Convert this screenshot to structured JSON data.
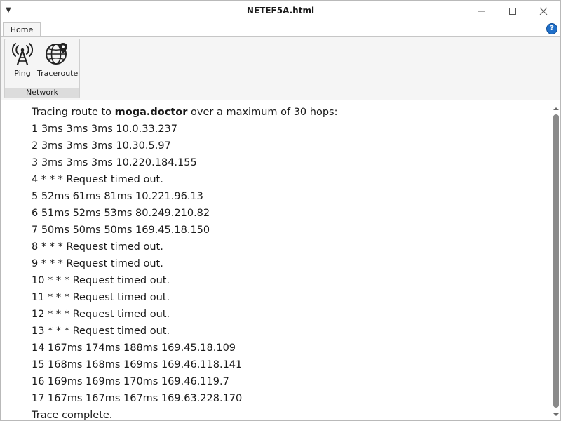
{
  "window": {
    "title": "NETEF5A.html",
    "quick_access_icon": "qat-arrow-icon",
    "controls": [
      "minimize-icon",
      "maximize-icon",
      "close-icon"
    ]
  },
  "ribbon": {
    "tabs": [
      {
        "label": "Home",
        "selected": true
      }
    ],
    "help_label": "?",
    "groups": [
      {
        "label": "Network",
        "buttons": [
          {
            "label": "Ping",
            "icon": "antenna-tower-icon"
          },
          {
            "label": "Traceroute",
            "icon": "globe-pin-icon"
          }
        ]
      }
    ]
  },
  "output": {
    "header_prefix": "Tracing route to ",
    "header_host": "moga.doctor",
    "header_suffix": " over a maximum of 30 hops:",
    "lines": [
      "1 3ms 3ms 3ms 10.0.33.237",
      "2 3ms 3ms 3ms 10.30.5.97",
      "3 3ms 3ms 3ms 10.220.184.155",
      "4 * * * Request timed out.",
      "5 52ms 61ms 81ms 10.221.96.13",
      "6 51ms 52ms 53ms 80.249.210.82",
      "7 50ms 50ms 50ms 169.45.18.150",
      "8 * * * Request timed out.",
      "9 * * * Request timed out.",
      "10 * * * Request timed out.",
      "11 * * * Request timed out.",
      "12 * * * Request timed out.",
      "13 * * * Request timed out.",
      "14 167ms 174ms 188ms 169.45.18.109",
      "15 168ms 168ms 169ms 169.46.118.141",
      "16 169ms 169ms 170ms 169.46.119.7",
      "17 167ms 167ms 167ms 169.63.228.170"
    ],
    "footer": "Trace complete."
  },
  "colors": {
    "ribbon_bg": "#f5f5f5",
    "group_label_bg": "#dcdcdc",
    "help_blue": "#1f6fc9",
    "scroll_thumb": "#8a8a8a"
  }
}
